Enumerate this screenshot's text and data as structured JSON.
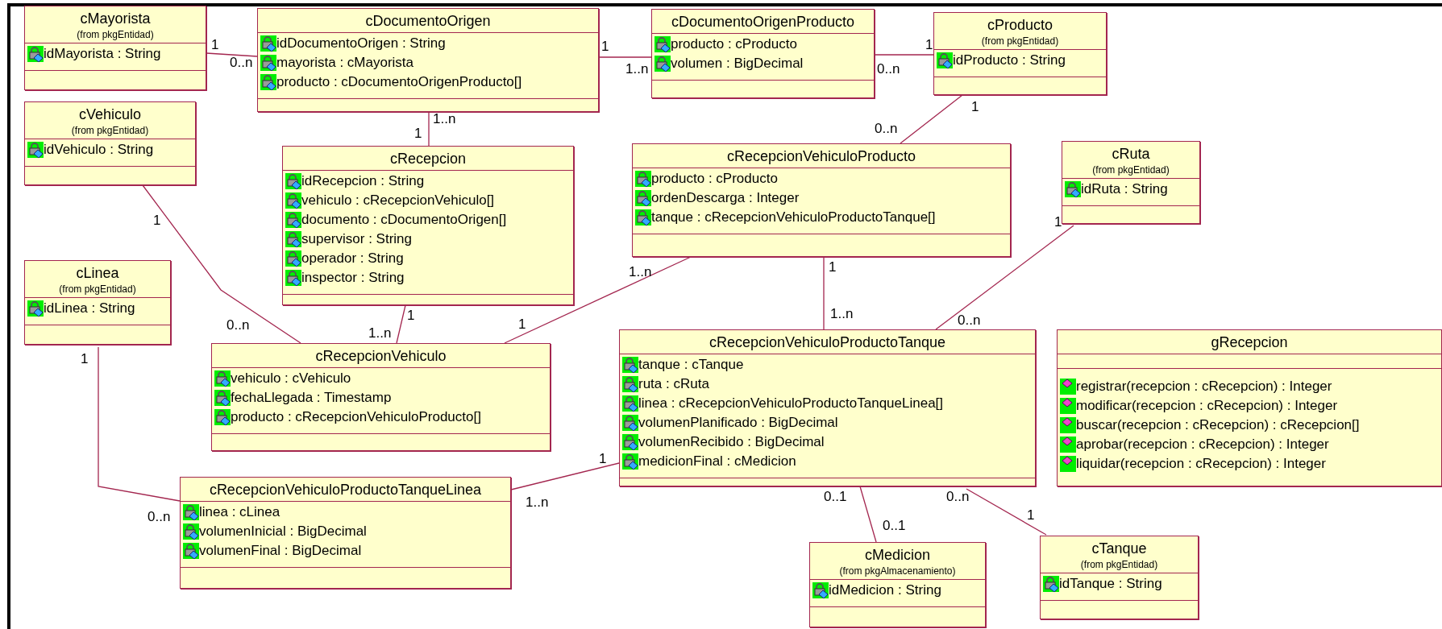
{
  "classes": [
    {
      "name": "cMayorista",
      "package": "(from pkgEntidad)",
      "attributes": [
        "idMayorista : String"
      ]
    },
    {
      "name": "cDocumentoOrigen",
      "attributes": [
        "idDocumentoOrigen : String",
        "mayorista : cMayorista",
        "producto : cDocumentoOrigenProducto[]"
      ]
    },
    {
      "name": "cDocumentoOrigenProducto",
      "attributes": [
        "producto : cProducto",
        "volumen : BigDecimal"
      ]
    },
    {
      "name": "cProducto",
      "package": "(from pkgEntidad)",
      "attributes": [
        "idProducto : String"
      ]
    },
    {
      "name": "cVehiculo",
      "package": "(from pkgEntidad)",
      "attributes": [
        "idVehiculo : String"
      ]
    },
    {
      "name": "cRecepcion",
      "attributes": [
        "idRecepcion : String",
        "vehiculo : cRecepcionVehiculo[]",
        "documento : cDocumentoOrigen[]",
        "supervisor : String",
        "operador : String",
        "inspector : String"
      ]
    },
    {
      "name": "cRecepcionVehiculoProducto",
      "attributes": [
        "producto : cProducto",
        "ordenDescarga : Integer",
        "tanque : cRecepcionVehiculoProductoTanque[]"
      ]
    },
    {
      "name": "cRuta",
      "package": "(from pkgEntidad)",
      "attributes": [
        "idRuta : String"
      ]
    },
    {
      "name": "cLinea",
      "package": "(from pkgEntidad)",
      "attributes": [
        "idLinea : String"
      ]
    },
    {
      "name": "cRecepcionVehiculo",
      "attributes": [
        "vehiculo : cVehiculo",
        "fechaLlegada : Timestamp",
        "producto : cRecepcionVehiculoProducto[]"
      ]
    },
    {
      "name": "cRecepcionVehiculoProductoTanque",
      "attributes": [
        "tanque : cTanque",
        "ruta : cRuta",
        "linea : cRecepcionVehiculoProductoTanqueLinea[]",
        "volumenPlanificado : BigDecimal",
        "volumenRecibido : BigDecimal",
        "medicionFinal : cMedicion"
      ]
    },
    {
      "name": "gRecepcion",
      "operations": [
        "registrar(recepcion : cRecepcion) : Integer",
        "modificar(recepcion : cRecepcion) : Integer",
        "buscar(recepcion : cRecepcion) : cRecepcion[]",
        "aprobar(recepcion : cRecepcion) : Integer",
        "liquidar(recepcion : cRecepcion) : Integer"
      ]
    },
    {
      "name": "cRecepcionVehiculoProductoTanqueLinea",
      "attributes": [
        "linea : cLinea",
        "volumenInicial : BigDecimal",
        "volumenFinal : BigDecimal"
      ]
    },
    {
      "name": "cMedicion",
      "package": "(from pkgAlmacenamiento)",
      "attributes": [
        "idMedicion : String"
      ]
    },
    {
      "name": "cTanque",
      "package": "(from pkgEntidad)",
      "attributes": [
        "idTanque : String"
      ]
    }
  ],
  "associations": [
    {
      "ends": [
        "1",
        "0..n"
      ]
    },
    {
      "ends": [
        "1",
        "1..n"
      ]
    },
    {
      "ends": [
        "0..n",
        "1"
      ]
    },
    {
      "ends": [
        "1..n",
        "1"
      ]
    },
    {
      "ends": [
        "1",
        "0..n"
      ]
    },
    {
      "ends": [
        "1",
        "0..n"
      ]
    },
    {
      "ends": [
        "1",
        "1..n"
      ]
    },
    {
      "ends": [
        "1..n",
        "1"
      ]
    },
    {
      "ends": [
        "1",
        "1..n"
      ]
    },
    {
      "ends": [
        "1",
        "0..n"
      ]
    },
    {
      "ends": [
        "1",
        "0..n"
      ]
    },
    {
      "ends": [
        "1",
        "1..n"
      ]
    },
    {
      "ends": [
        "0..1",
        "0..1"
      ]
    },
    {
      "ends": [
        "0..n",
        "1"
      ]
    }
  ]
}
